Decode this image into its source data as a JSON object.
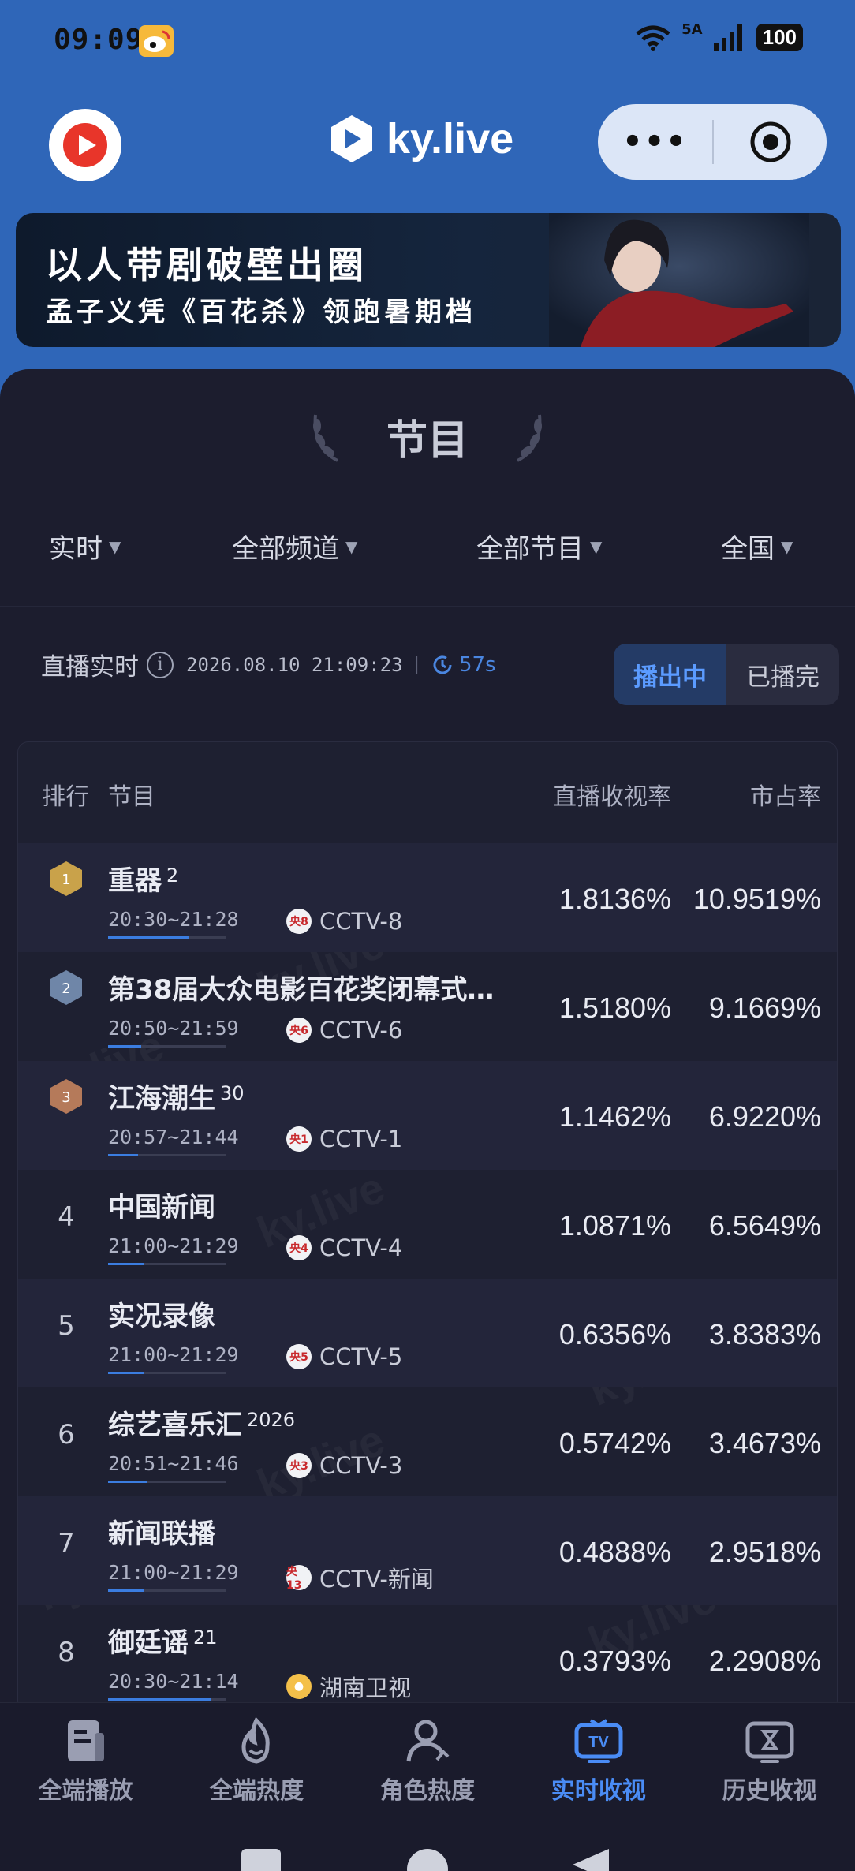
{
  "status_bar": {
    "time": "09:09",
    "network": "5A",
    "battery": "100"
  },
  "app": {
    "brand": "ky.live",
    "more_label": "•••"
  },
  "banner": {
    "line1": "以人带剧破壁出圈",
    "line2": "孟子义凭《百花杀》领跑暑期档"
  },
  "section": {
    "title": "节目"
  },
  "filters": [
    {
      "label": "实时"
    },
    {
      "label": "全部频道"
    },
    {
      "label": "全部节目"
    },
    {
      "label": "全国"
    }
  ],
  "live_info": {
    "label": "直播实时",
    "timestamp": "2026.08.10 21:09:23",
    "refresh": "57s"
  },
  "toggle": {
    "active": "播出中",
    "inactive": "已播完"
  },
  "table": {
    "headers": {
      "rank": "排行",
      "program": "节目",
      "rating": "直播收视率",
      "share": "市占率"
    },
    "rows": [
      {
        "rank": "1",
        "title": "重器",
        "ep": "2",
        "time": "20:30~21:28",
        "channel": "CCTV-8",
        "badge": "央8",
        "rating": "1.8136%",
        "share": "10.9519%",
        "progress": 0.68,
        "medal": "gold"
      },
      {
        "rank": "2",
        "title": "第38届大众电影百花奖闭幕式…",
        "ep": "",
        "time": "20:50~21:59",
        "channel": "CCTV-6",
        "badge": "央6",
        "rating": "1.5180%",
        "share": "9.1669%",
        "progress": 0.28,
        "medal": "silver"
      },
      {
        "rank": "3",
        "title": "江海潮生",
        "ep": "30",
        "time": "20:57~21:44",
        "channel": "CCTV-1",
        "badge": "央1",
        "rating": "1.1462%",
        "share": "6.9220%",
        "progress": 0.25,
        "medal": "bronze"
      },
      {
        "rank": "4",
        "title": "中国新闻",
        "ep": "",
        "time": "21:00~21:29",
        "channel": "CCTV-4",
        "badge": "央4",
        "rating": "1.0871%",
        "share": "6.5649%",
        "progress": 0.3,
        "medal": ""
      },
      {
        "rank": "5",
        "title": "实况录像",
        "ep": "",
        "time": "21:00~21:29",
        "channel": "CCTV-5",
        "badge": "央5",
        "rating": "0.6356%",
        "share": "3.8383%",
        "progress": 0.3,
        "medal": ""
      },
      {
        "rank": "6",
        "title": "综艺喜乐汇",
        "ep": "2026",
        "time": "20:51~21:46",
        "channel": "CCTV-3",
        "badge": "央3",
        "rating": "0.5742%",
        "share": "3.4673%",
        "progress": 0.33,
        "medal": ""
      },
      {
        "rank": "7",
        "title": "新闻联播",
        "ep": "",
        "time": "21:00~21:29",
        "channel": "CCTV-新闻",
        "badge": "央13",
        "rating": "0.4888%",
        "share": "2.9518%",
        "progress": 0.3,
        "medal": ""
      },
      {
        "rank": "8",
        "title": "御廷谣",
        "ep": "21",
        "time": "20:30~21:14",
        "channel": "湖南卫视",
        "badge": "",
        "rating": "0.3793%",
        "share": "2.2908%",
        "progress": 0.87,
        "medal": ""
      }
    ]
  },
  "bottom_nav": [
    {
      "label": "全端播放",
      "icon": "document-icon",
      "active": false
    },
    {
      "label": "全端热度",
      "icon": "flame-icon",
      "active": false
    },
    {
      "label": "角色热度",
      "icon": "person-icon",
      "active": false
    },
    {
      "label": "实时收视",
      "icon": "tv-icon",
      "active": true
    },
    {
      "label": "历史收视",
      "icon": "hourglass-tv-icon",
      "active": false
    }
  ],
  "colors": {
    "header_blue": "#2f66b8",
    "panel": "#1c1d2e",
    "accent": "#4a8cf5",
    "gold": "#c9a24a",
    "silver": "#6f86a8",
    "bronze": "#b57a5a"
  }
}
